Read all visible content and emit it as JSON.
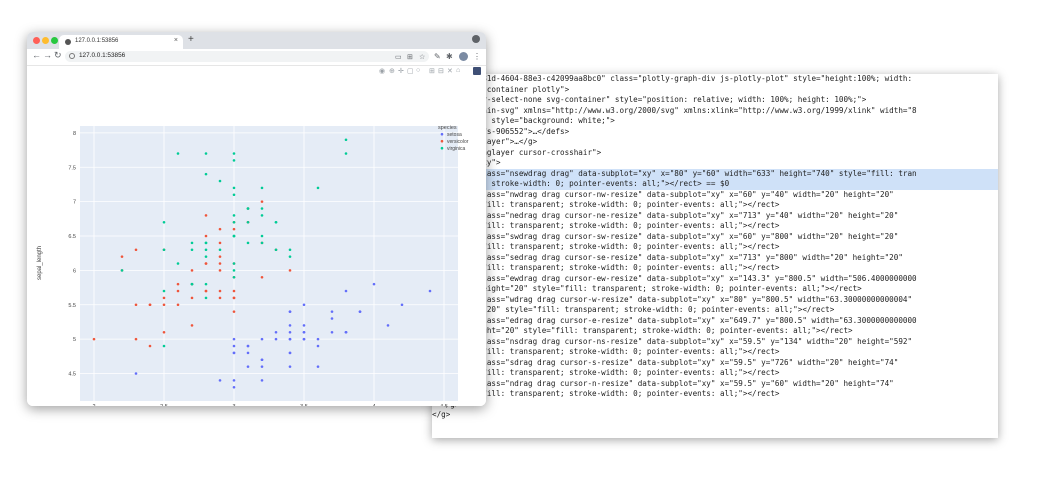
{
  "browser": {
    "tab_title": "127.0.0.1:53856",
    "url": "127.0.0.1:53856",
    "new_tab": "+",
    "close": "×"
  },
  "chart_data": {
    "type": "scatter",
    "title": "",
    "xlabel": "sepal_width",
    "ylabel": "sepal_length",
    "xlim": [
      1.9,
      4.6
    ],
    "ylim": [
      4.1,
      8.1
    ],
    "xticks": [
      "2",
      "2.5",
      "3",
      "3.5",
      "4",
      "4.5"
    ],
    "xtick_values": [
      2,
      2.5,
      3,
      3.5,
      4,
      4.5
    ],
    "yticks": [
      "4.5",
      "5",
      "5.5",
      "6",
      "6.5",
      "7",
      "7.5",
      "8"
    ],
    "ytick_values": [
      4.5,
      5,
      5.5,
      6,
      6.5,
      7,
      7.5,
      8
    ],
    "grid": true,
    "legend_title": "species",
    "legend_position": "top-right",
    "series": [
      {
        "name": "setosa",
        "color": "#636efa",
        "x": [
          3.5,
          3.0,
          3.2,
          3.1,
          3.6,
          3.9,
          3.4,
          3.4,
          2.9,
          3.1,
          3.7,
          3.4,
          3.0,
          3.0,
          4.0,
          4.4,
          3.9,
          3.5,
          3.8,
          3.8,
          3.4,
          3.7,
          3.6,
          3.3,
          3.4,
          3.0,
          3.4,
          3.5,
          3.4,
          3.2,
          3.1,
          3.4,
          4.1,
          4.2,
          3.1,
          3.2,
          3.5,
          3.6,
          3.0,
          3.4,
          3.5,
          2.3,
          3.2,
          3.5,
          3.8,
          3.0,
          3.8,
          3.2,
          3.7,
          3.3
        ],
        "y": [
          5.1,
          4.9,
          4.7,
          4.6,
          5.0,
          5.4,
          4.6,
          5.0,
          4.4,
          4.9,
          5.4,
          4.8,
          4.8,
          4.3,
          5.8,
          5.7,
          5.4,
          5.1,
          5.7,
          5.1,
          5.4,
          5.1,
          4.6,
          5.1,
          4.8,
          5.0,
          5.0,
          5.2,
          5.2,
          4.7,
          4.8,
          5.4,
          5.2,
          5.5,
          4.9,
          5.0,
          5.5,
          4.9,
          4.4,
          5.1,
          5.0,
          4.5,
          4.4,
          5.0,
          5.1,
          4.8,
          5.1,
          4.6,
          5.3,
          5.0
        ]
      },
      {
        "name": "versicolor",
        "color": "#ef553b",
        "x": [
          3.2,
          3.2,
          3.1,
          2.3,
          2.8,
          2.8,
          3.3,
          2.4,
          2.9,
          2.7,
          2.0,
          3.0,
          2.2,
          2.9,
          2.9,
          3.1,
          3.0,
          2.7,
          2.2,
          2.5,
          3.2,
          2.8,
          2.5,
          2.8,
          2.9,
          3.0,
          2.8,
          3.0,
          2.9,
          2.6,
          2.4,
          2.4,
          2.7,
          2.7,
          3.0,
          3.4,
          3.1,
          2.3,
          3.0,
          2.5,
          2.6,
          3.0,
          2.6,
          2.3,
          2.7,
          3.0,
          2.9,
          2.9,
          2.5,
          2.8
        ],
        "y": [
          7.0,
          6.4,
          6.9,
          5.5,
          6.5,
          5.7,
          6.3,
          4.9,
          6.6,
          5.2,
          5.0,
          5.9,
          6.0,
          6.1,
          5.6,
          6.7,
          5.6,
          5.8,
          6.2,
          5.6,
          5.9,
          6.1,
          6.3,
          6.1,
          6.4,
          6.6,
          6.8,
          6.7,
          6.0,
          5.7,
          5.5,
          5.5,
          5.8,
          6.0,
          5.4,
          6.0,
          6.7,
          6.3,
          5.6,
          5.5,
          5.5,
          6.1,
          5.8,
          5.0,
          5.6,
          5.7,
          5.7,
          6.2,
          5.1,
          5.7
        ]
      },
      {
        "name": "virginica",
        "color": "#00cc96",
        "x": [
          3.3,
          2.7,
          3.0,
          2.9,
          3.0,
          3.0,
          2.5,
          2.9,
          2.5,
          3.6,
          3.2,
          2.7,
          3.0,
          2.5,
          2.8,
          3.2,
          3.0,
          3.8,
          2.6,
          2.2,
          3.2,
          2.8,
          2.8,
          2.7,
          3.3,
          3.2,
          2.8,
          3.0,
          2.8,
          3.0,
          2.8,
          3.8,
          2.8,
          2.8,
          2.6,
          3.0,
          3.4,
          3.1,
          3.0,
          3.1,
          3.1,
          3.1,
          2.7,
          3.2,
          3.3,
          3.0,
          2.5,
          3.0,
          3.4,
          3.0
        ],
        "y": [
          6.3,
          5.8,
          7.1,
          6.3,
          6.5,
          7.6,
          4.9,
          7.3,
          6.7,
          7.2,
          6.5,
          6.4,
          6.8,
          5.7,
          5.8,
          6.4,
          6.5,
          7.7,
          7.7,
          6.0,
          6.9,
          5.6,
          7.7,
          6.3,
          6.7,
          7.2,
          6.2,
          6.1,
          6.4,
          7.2,
          7.4,
          7.9,
          6.4,
          6.3,
          6.1,
          7.7,
          6.3,
          6.4,
          6.0,
          6.9,
          6.7,
          6.9,
          5.8,
          6.8,
          6.7,
          6.7,
          6.3,
          6.5,
          6.2,
          5.9
        ]
      }
    ]
  },
  "devtools": {
    "lines": [
      {
        "t": "\"7fe598e6-781d-4604-88e3-c42099aa8bc0\" class=\"plotly-graph-div js-plotly-plot\" style=\"height:100%; width:"
      },
      {
        "t": "class=\"plot-container plotly\">"
      },
      {
        "t": " class=\"user-select-none svg-container\" style=\"position: relative; width: 100%; height: 100%;\">"
      },
      {
        "t": "vg class=\"main-svg\" xmlns=\"http://www.w3.org/2000/svg\" xmlns:xlink=\"http://www.w3.org/1999/xlink\" width=\"8"
      },
      {
        "t": "height=\"880\" style=\"background: white;\">"
      },
      {
        "t": "defs id=\"defs-906552\">…</defs>"
      },
      {
        "t": "g class=\"bglayer\">…</g>"
      },
      {
        "t": "g class=\"draglayer cursor-crosshair\">"
      },
      {
        "t": "▾<g class=\"xy\">"
      },
      {
        "t": "    <rect class=\"nsewdrag drag\" data-subplot=\"xy\" x=\"80\" y=\"60\" width=\"633\" height=\"740\" style=\"fill: tran",
        "hl": true
      },
      {
        "t": "    sparent; stroke-width: 0; pointer-events: all;\"></rect> == $0",
        "hl": true
      },
      {
        "t": "    <rect class=\"nwdrag drag cursor-nw-resize\" data-subplot=\"xy\" x=\"60\" y=\"40\" width=\"20\" height=\"20\""
      },
      {
        "t": "    style=\"fill: transparent; stroke-width: 0; pointer-events: all;\"></rect>"
      },
      {
        "t": "    <rect class=\"nedrag drag cursor-ne-resize\" data-subplot=\"xy\" x=\"713\" y=\"40\" width=\"20\" height=\"20\""
      },
      {
        "t": "    style=\"fill: transparent; stroke-width: 0; pointer-events: all;\"></rect>"
      },
      {
        "t": "    <rect class=\"swdrag drag cursor-sw-resize\" data-subplot=\"xy\" x=\"60\" y=\"800\" width=\"20\" height=\"20\""
      },
      {
        "t": "    style=\"fill: transparent; stroke-width: 0; pointer-events: all;\"></rect>"
      },
      {
        "t": "    <rect class=\"sedrag drag cursor-se-resize\" data-subplot=\"xy\" x=\"713\" y=\"800\" width=\"20\" height=\"20\""
      },
      {
        "t": "    style=\"fill: transparent; stroke-width: 0; pointer-events: all;\"></rect>"
      },
      {
        "t": "    <rect class=\"ewdrag drag cursor-ew-resize\" data-subplot=\"xy\" x=\"143.3\" y=\"800.5\" width=\"506.4000000000"
      },
      {
        "t": "    0003\" height=\"20\" style=\"fill: transparent; stroke-width: 0; pointer-events: all;\"></rect>"
      },
      {
        "t": "    <rect class=\"wdrag drag cursor-w-resize\" data-subplot=\"xy\" x=\"80\" y=\"800.5\" width=\"63.30000000000004\""
      },
      {
        "t": "    height=\"20\" style=\"fill: transparent; stroke-width: 0; pointer-events: all;\"></rect>"
      },
      {
        "t": "    <rect class=\"edrag drag cursor-e-resize\" data-subplot=\"xy\" x=\"649.7\" y=\"800.5\" width=\"63.3000000000000"
      },
      {
        "t": "    04\" height=\"20\" style=\"fill: transparent; stroke-width: 0; pointer-events: all;\"></rect>"
      },
      {
        "t": "    <rect class=\"nsdrag drag cursor-ns-resize\" data-subplot=\"xy\" x=\"59.5\" y=\"134\" width=\"20\" height=\"592\""
      },
      {
        "t": "    style=\"fill: transparent; stroke-width: 0; pointer-events: all;\"></rect>"
      },
      {
        "t": "    <rect class=\"sdrag drag cursor-s-resize\" data-subplot=\"xy\" x=\"59.5\" y=\"726\" width=\"20\" height=\"74\""
      },
      {
        "t": "    style=\"fill: transparent; stroke-width: 0; pointer-events: all;\"></rect>"
      },
      {
        "t": "    <rect class=\"ndrag drag cursor-n-resize\" data-subplot=\"xy\" x=\"59.5\" y=\"60\" width=\"20\" height=\"74\""
      },
      {
        "t": "    style=\"fill: transparent; stroke-width: 0; pointer-events: all;\"></rect>"
      },
      {
        "t": "  </g>"
      },
      {
        "t": "</g>"
      }
    ]
  }
}
